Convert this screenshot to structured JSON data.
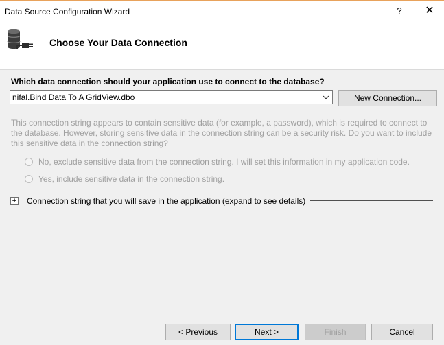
{
  "window": {
    "title": "Data Source Configuration Wizard",
    "help_glyph": "?",
    "close_glyph": "✕"
  },
  "header": {
    "title": "Choose Your Data Connection",
    "icon": "database-connection-icon"
  },
  "connection": {
    "question": "Which data connection should your application use to connect to the database?",
    "selected": "nifal.Bind Data To A GridView.dbo",
    "new_connection_label": "New Connection..."
  },
  "sensitive": {
    "description": "This connection string appears to contain sensitive data (for example, a password), which is required to connect to the database. However, storing sensitive data in the connection string can be a security risk. Do you want to include this sensitive data in the connection string?",
    "option_exclude": "No, exclude sensitive data from the connection string. I will set this information in my application code.",
    "option_include": "Yes, include sensitive data in the connection string.",
    "enabled": false
  },
  "expander": {
    "glyph": "+",
    "label": "Connection string that you will save in the application (expand to see details)"
  },
  "footer": {
    "previous_label": "< Previous",
    "next_label": "Next >",
    "finish_label": "Finish",
    "cancel_label": "Cancel"
  }
}
